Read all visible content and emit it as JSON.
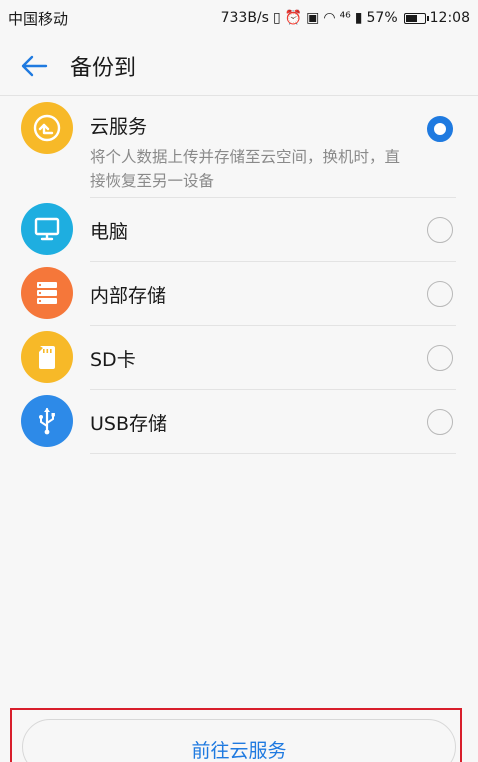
{
  "status_bar": {
    "carrier": "中国移动",
    "net_speed": "733B/s",
    "network": "⁴⁶",
    "battery": "57%",
    "time": "12:08"
  },
  "app_bar": {
    "title": "备份到"
  },
  "options": [
    {
      "id": "cloud",
      "label": "云服务",
      "description": "将个人数据上传并存储至云空间，换机时，直接恢复至另一设备",
      "icon": "cloud-sync-icon",
      "color": "#f7b928",
      "checked": true
    },
    {
      "id": "pc",
      "label": "电脑",
      "icon": "monitor-icon",
      "color": "#1eaee0",
      "checked": false
    },
    {
      "id": "internal",
      "label": "内部存储",
      "icon": "storage-icon",
      "color": "#f5773a",
      "checked": false
    },
    {
      "id": "sd",
      "label": "SD卡",
      "icon": "sd-card-icon",
      "color": "#f7b928",
      "checked": false
    },
    {
      "id": "usb",
      "label": "USB存储",
      "icon": "usb-icon",
      "color": "#2d8ae8",
      "checked": false
    }
  ],
  "go_button": {
    "label": "前往云服务"
  }
}
